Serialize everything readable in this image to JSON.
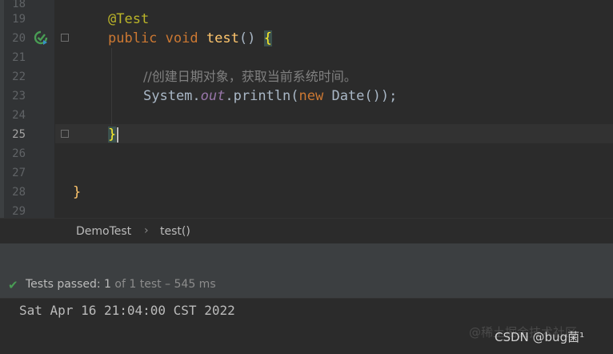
{
  "editor": {
    "line_numbers": [
      "18",
      "19",
      "20",
      "21",
      "22",
      "23",
      "24",
      "25",
      "26",
      "27",
      "28",
      "29"
    ],
    "active_line": "25",
    "lines": {
      "l19_annotation": "@Test",
      "l20_kw_public": "public",
      "l20_kw_void": "void",
      "l20_fn": "test",
      "l20_parens": "()",
      "l20_brace": "{",
      "l22_comment": "//创建日期对象，获取当前系统时间。",
      "l23_sys": "System.",
      "l23_out": "out",
      "l23_println": ".println(",
      "l23_new": "new",
      "l23_date": " Date());",
      "l25_brace": "}",
      "l28_brace": "}"
    },
    "run_icon": "run-gutter-icon"
  },
  "breadcrumb": {
    "class_name": "DemoTest",
    "method_name": "test()"
  },
  "run_panel": {
    "status_label": "Tests passed:",
    "passed_count": "1",
    "status_detail": "of 1 test – 545 ms",
    "output_line": "Sat Apr 16 21:04:00 CST 2022",
    "status_icon": "check-icon"
  },
  "watermark": {
    "text": "CSDN @bug菌¹",
    "ghost_text": "@稀土掘金技术社区"
  },
  "colors": {
    "background": "#2b2b2b",
    "keyword": "#cc7832",
    "annotation": "#bbb529",
    "function": "#ffc66d",
    "success": "#499c54"
  }
}
